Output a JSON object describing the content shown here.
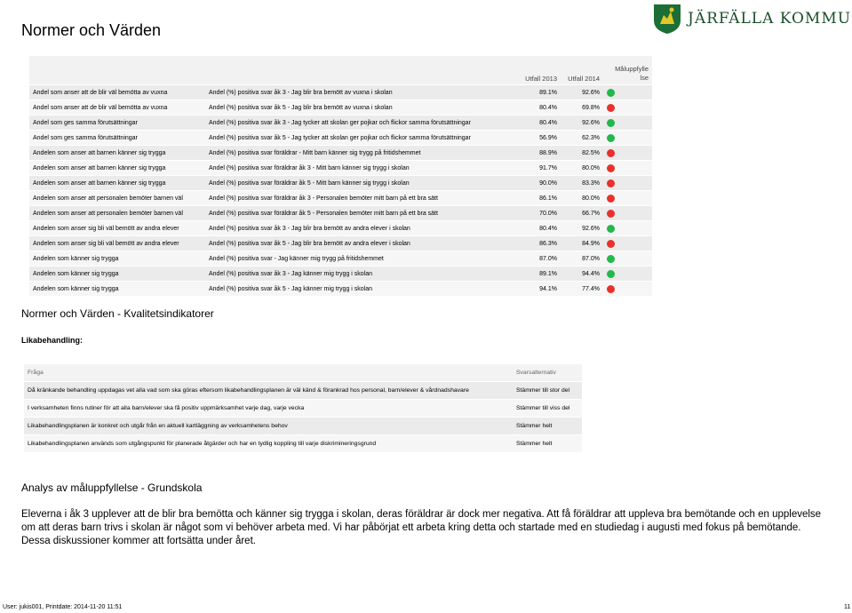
{
  "page_title": "Normer och Värden",
  "logo": {
    "text": "JÄRFÄLLA KOMMUN",
    "colors": {
      "green": "#1b6e35",
      "gold": "#e3c72a"
    }
  },
  "main_table": {
    "headers": {
      "utfall_2013": "Utfall  2013",
      "utfall_2014": "Utfall  2014",
      "goal": "Måluppfylle lse"
    },
    "rows": [
      {
        "indicator": "Andel som anser att de blir väl bemötta av vuxna",
        "question": "Andel (%) positiva svar åk 3 - Jag blir bra bemött av vuxna i skolan",
        "v2013": "89.1%",
        "v2014": "92.6%",
        "status": "green"
      },
      {
        "indicator": "Andel som anser att de blir väl bemötta av vuxna",
        "question": "Andel (%) positiva svar åk 5 - Jag blir bra bemött av vuxna i skolan",
        "v2013": "80.4%",
        "v2014": "69.8%",
        "status": "red"
      },
      {
        "indicator": "Andel som ges samma förutsättningar",
        "question": "Andel (%) positiva svar åk 3 - Jag tycker att skolan ger pojkar och flickor samma förutsättningar",
        "v2013": "80.4%",
        "v2014": "92.6%",
        "status": "green"
      },
      {
        "indicator": "Andel som ges samma förutsättningar",
        "question": "Andel (%) positiva svar åk 5 - Jag tycker att skolan ger pojkar och flickor samma förutsättningar",
        "v2013": "56.9%",
        "v2014": "62.3%",
        "status": "green"
      },
      {
        "indicator": "Andelen som anser att barnen känner sig trygga",
        "question": "Andel (%) positiva svar föräldrar - Mitt barn känner sig trygg på fritidshemmet",
        "v2013": "88.9%",
        "v2014": "82.5%",
        "status": "red"
      },
      {
        "indicator": "Andelen som anser att barnen känner sig trygga",
        "question": "Andel (%) positiva svar föräldrar åk 3 - Mitt barn känner sig trygg i skolan",
        "v2013": "91.7%",
        "v2014": "80.0%",
        "status": "red"
      },
      {
        "indicator": "Andelen som anser att barnen känner sig trygga",
        "question": "Andel (%) positiva svar föräldrar åk 5 - Mitt barn känner sig trygg i skolan",
        "v2013": "90.0%",
        "v2014": "83.3%",
        "status": "red"
      },
      {
        "indicator": "Andelen som anser att personalen bemöter barnen väl",
        "question": "Andel (%) positiva svar föräldrar åk 3 - Personalen bemöter mitt barn på ett bra sätt",
        "v2013": "86.1%",
        "v2014": "80.0%",
        "status": "red"
      },
      {
        "indicator": "Andelen som anser att personalen bemöter barnen väl",
        "question": "Andel (%) positiva svar föräldrar åk 5 - Personalen bemöter mitt barn på ett bra sätt",
        "v2013": "70.0%",
        "v2014": "66.7%",
        "status": "red"
      },
      {
        "indicator": "Andelen som anser sig bli väl bemött av andra elever",
        "question": "Andel (%) positiva svar åk 3 - Jag blir bra bemött av andra elever i skolan",
        "v2013": "80.4%",
        "v2014": "92.6%",
        "status": "green"
      },
      {
        "indicator": "Andelen som anser sig bli väl bemött av andra elever",
        "question": "Andel (%) positiva svar åk 5 - Jag blir bra bemött av andra elever i skolan",
        "v2013": "86.3%",
        "v2014": "84.9%",
        "status": "red"
      },
      {
        "indicator": "Andelen som känner sig trygga",
        "question": "Andel (%) positiva svar - Jag känner mig trygg på fritidshemmet",
        "v2013": "87.0%",
        "v2014": "87.0%",
        "status": "green"
      },
      {
        "indicator": "Andelen som känner sig trygga",
        "question": "Andel (%) positiva svar åk 3 - Jag känner mig trygg i skolan",
        "v2013": "89.1%",
        "v2014": "94.4%",
        "status": "green"
      },
      {
        "indicator": "Andelen som känner sig trygga",
        "question": "Andel (%) positiva svar åk 5 - Jag känner mig trygg i skolan",
        "v2013": "94.1%",
        "v2014": "77.4%",
        "status": "red"
      }
    ],
    "status_colors": {
      "green": "#22b84a",
      "red": "#e8312b"
    }
  },
  "subtitle": "Normer och Värden - Kvalitetsindikatorer",
  "section_label": "Likabehandling:",
  "questions_table": {
    "headers": {
      "question": "Fråga",
      "answer": "Svarsalternativ"
    },
    "rows": [
      {
        "question": "Då kränkande behandling uppdagas vet alla vad som ska göras eftersom likabehandlingsplanen är väl känd & förankrad hos personal, barn/elever & vårdnadshavare",
        "answer": "Stämmer till stor del"
      },
      {
        "question": "I verksamheten finns rutiner för att alla barn/elever ska få positiv uppmärksamhet varje dag, varje vecka",
        "answer": "Stämmer till viss del"
      },
      {
        "question": "Likabehandlingsplanen är konkret och utgår från en aktuell kartläggning av verksamhetens behov",
        "answer": "Stämmer helt"
      },
      {
        "question": "Likabehandlingsplanen används som utgångspunkt för planerade åtgärder och har en tydlig koppling till varje diskrimineringsgrund",
        "answer": "Stämmer helt"
      }
    ]
  },
  "analysis": {
    "title": "Analys av måluppfyllelse - Grundskola",
    "text": "Eleverna i åk 3 upplever att de blir bra bemötta och känner sig trygga i skolan, deras föräldrar är dock mer negativa. Att få föräldrar att uppleva bra bemötande och en upplevelse om att deras barn trivs i skolan är något som vi behöver arbeta med. Vi har påbörjat ett arbeta kring detta och startade med en studiedag i augusti med fokus på bemötande. Dessa diskussioner kommer att fortsätta under året."
  },
  "footer": {
    "user_print": "User: jukis001, Printdate: 2014-11-20 11:51",
    "page_number": "11"
  }
}
